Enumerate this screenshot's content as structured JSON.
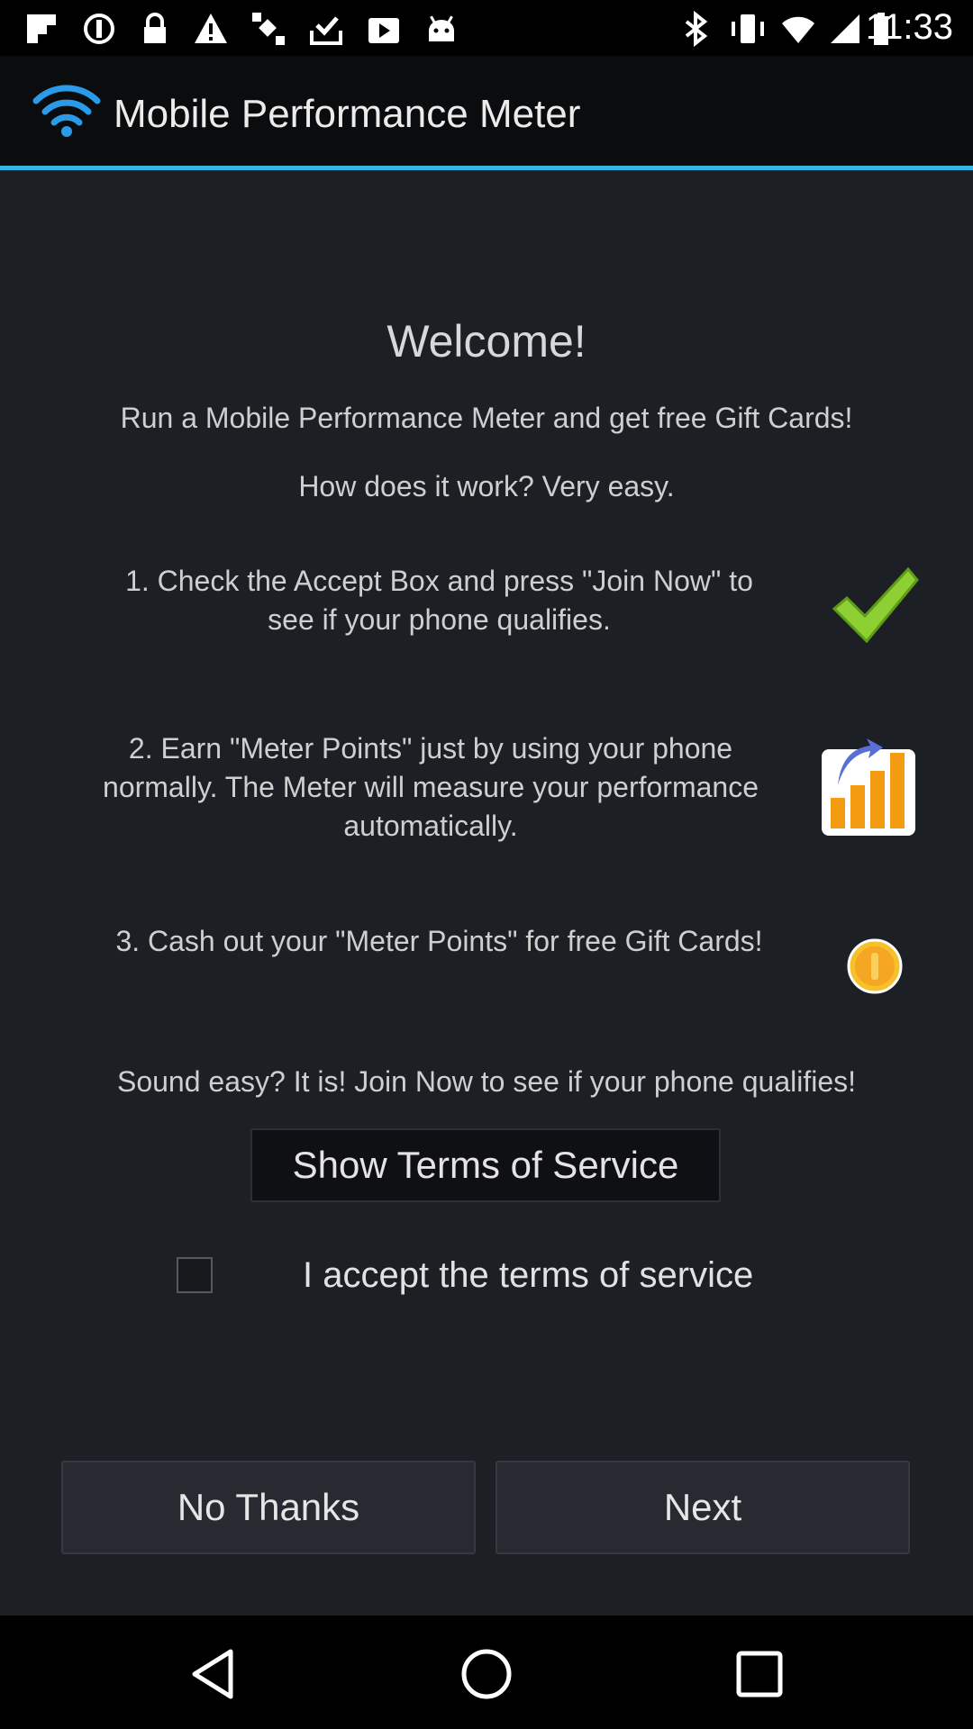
{
  "status_bar": {
    "time": "11:33",
    "icons_left": [
      "flipboard-icon",
      "do-not-disturb-icon",
      "lock-icon",
      "warning-icon",
      "fake-gps-icon",
      "download-done-icon",
      "play-store-icon",
      "android-icon"
    ],
    "icons_right": [
      "bluetooth-icon",
      "vibrate-icon",
      "wifi-icon",
      "signal-icon",
      "battery-icon"
    ]
  },
  "app_bar": {
    "title": "Mobile Performance Meter",
    "icon": "wifi-logo-icon",
    "accent_color": "#33b5e5"
  },
  "content": {
    "welcome": "Welcome!",
    "intro": "Run a Mobile Performance Meter and get free Gift Cards!",
    "how": "How does it work? Very easy.",
    "steps": [
      {
        "line1": "1. Check the Accept Box and press \"Join Now\" to",
        "line2": "see if your phone qualifies.",
        "icon": "checkmark-icon"
      },
      {
        "line1": "2. Earn \"Meter Points\" just by using your phone",
        "line2": "normally. The Meter will measure your performance",
        "line3": "automatically.",
        "icon": "bar-chart-icon"
      },
      {
        "line1": "3. Cash out your \"Meter Points\" for free Gift Cards!",
        "icon": "coin-icon"
      }
    ],
    "sound_easy": "Sound easy? It is! Join Now to see if your phone qualifies!",
    "tos_button": "Show Terms of Service",
    "accept_label": "I accept the terms of service",
    "accept_checked": false
  },
  "buttons": {
    "no_thanks": "No Thanks",
    "next": "Next"
  },
  "nav_bar": {
    "icons": [
      "back-icon",
      "home-icon",
      "recents-icon"
    ]
  }
}
